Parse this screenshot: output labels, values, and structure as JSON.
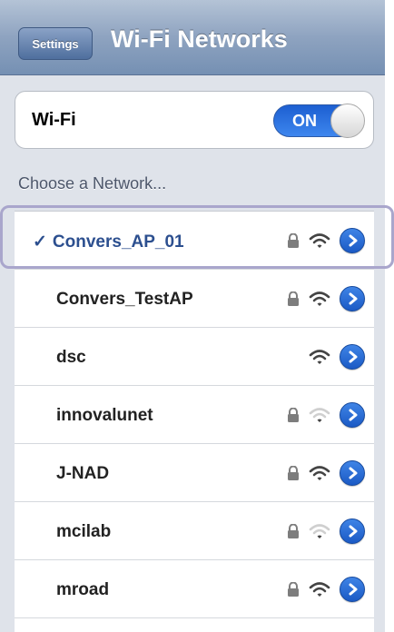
{
  "navbar": {
    "back_label": "Settings",
    "title": "Wi-Fi Networks"
  },
  "wifi_toggle": {
    "label": "Wi-Fi",
    "state": "ON"
  },
  "section_header": "Choose a Network...",
  "networks": [
    {
      "name": "Convers_AP_01",
      "secured": true,
      "signal": 3,
      "selected": true,
      "check": "✓"
    },
    {
      "name": "Convers_TestAP",
      "secured": true,
      "signal": 3,
      "selected": false
    },
    {
      "name": "dsc",
      "secured": false,
      "signal": 3,
      "selected": false
    },
    {
      "name": "innovalunet",
      "secured": true,
      "signal": 1,
      "selected": false
    },
    {
      "name": "J-NAD",
      "secured": true,
      "signal": 3,
      "selected": false
    },
    {
      "name": "mcilab",
      "secured": true,
      "signal": 1,
      "selected": false
    },
    {
      "name": "mroad",
      "secured": true,
      "signal": 3,
      "selected": false
    }
  ],
  "colors": {
    "accent": "#2c6bd6",
    "navbar": "#7f98bb",
    "selected_text": "#2c4f8f",
    "highlight_outline": "#a9a6cc"
  }
}
